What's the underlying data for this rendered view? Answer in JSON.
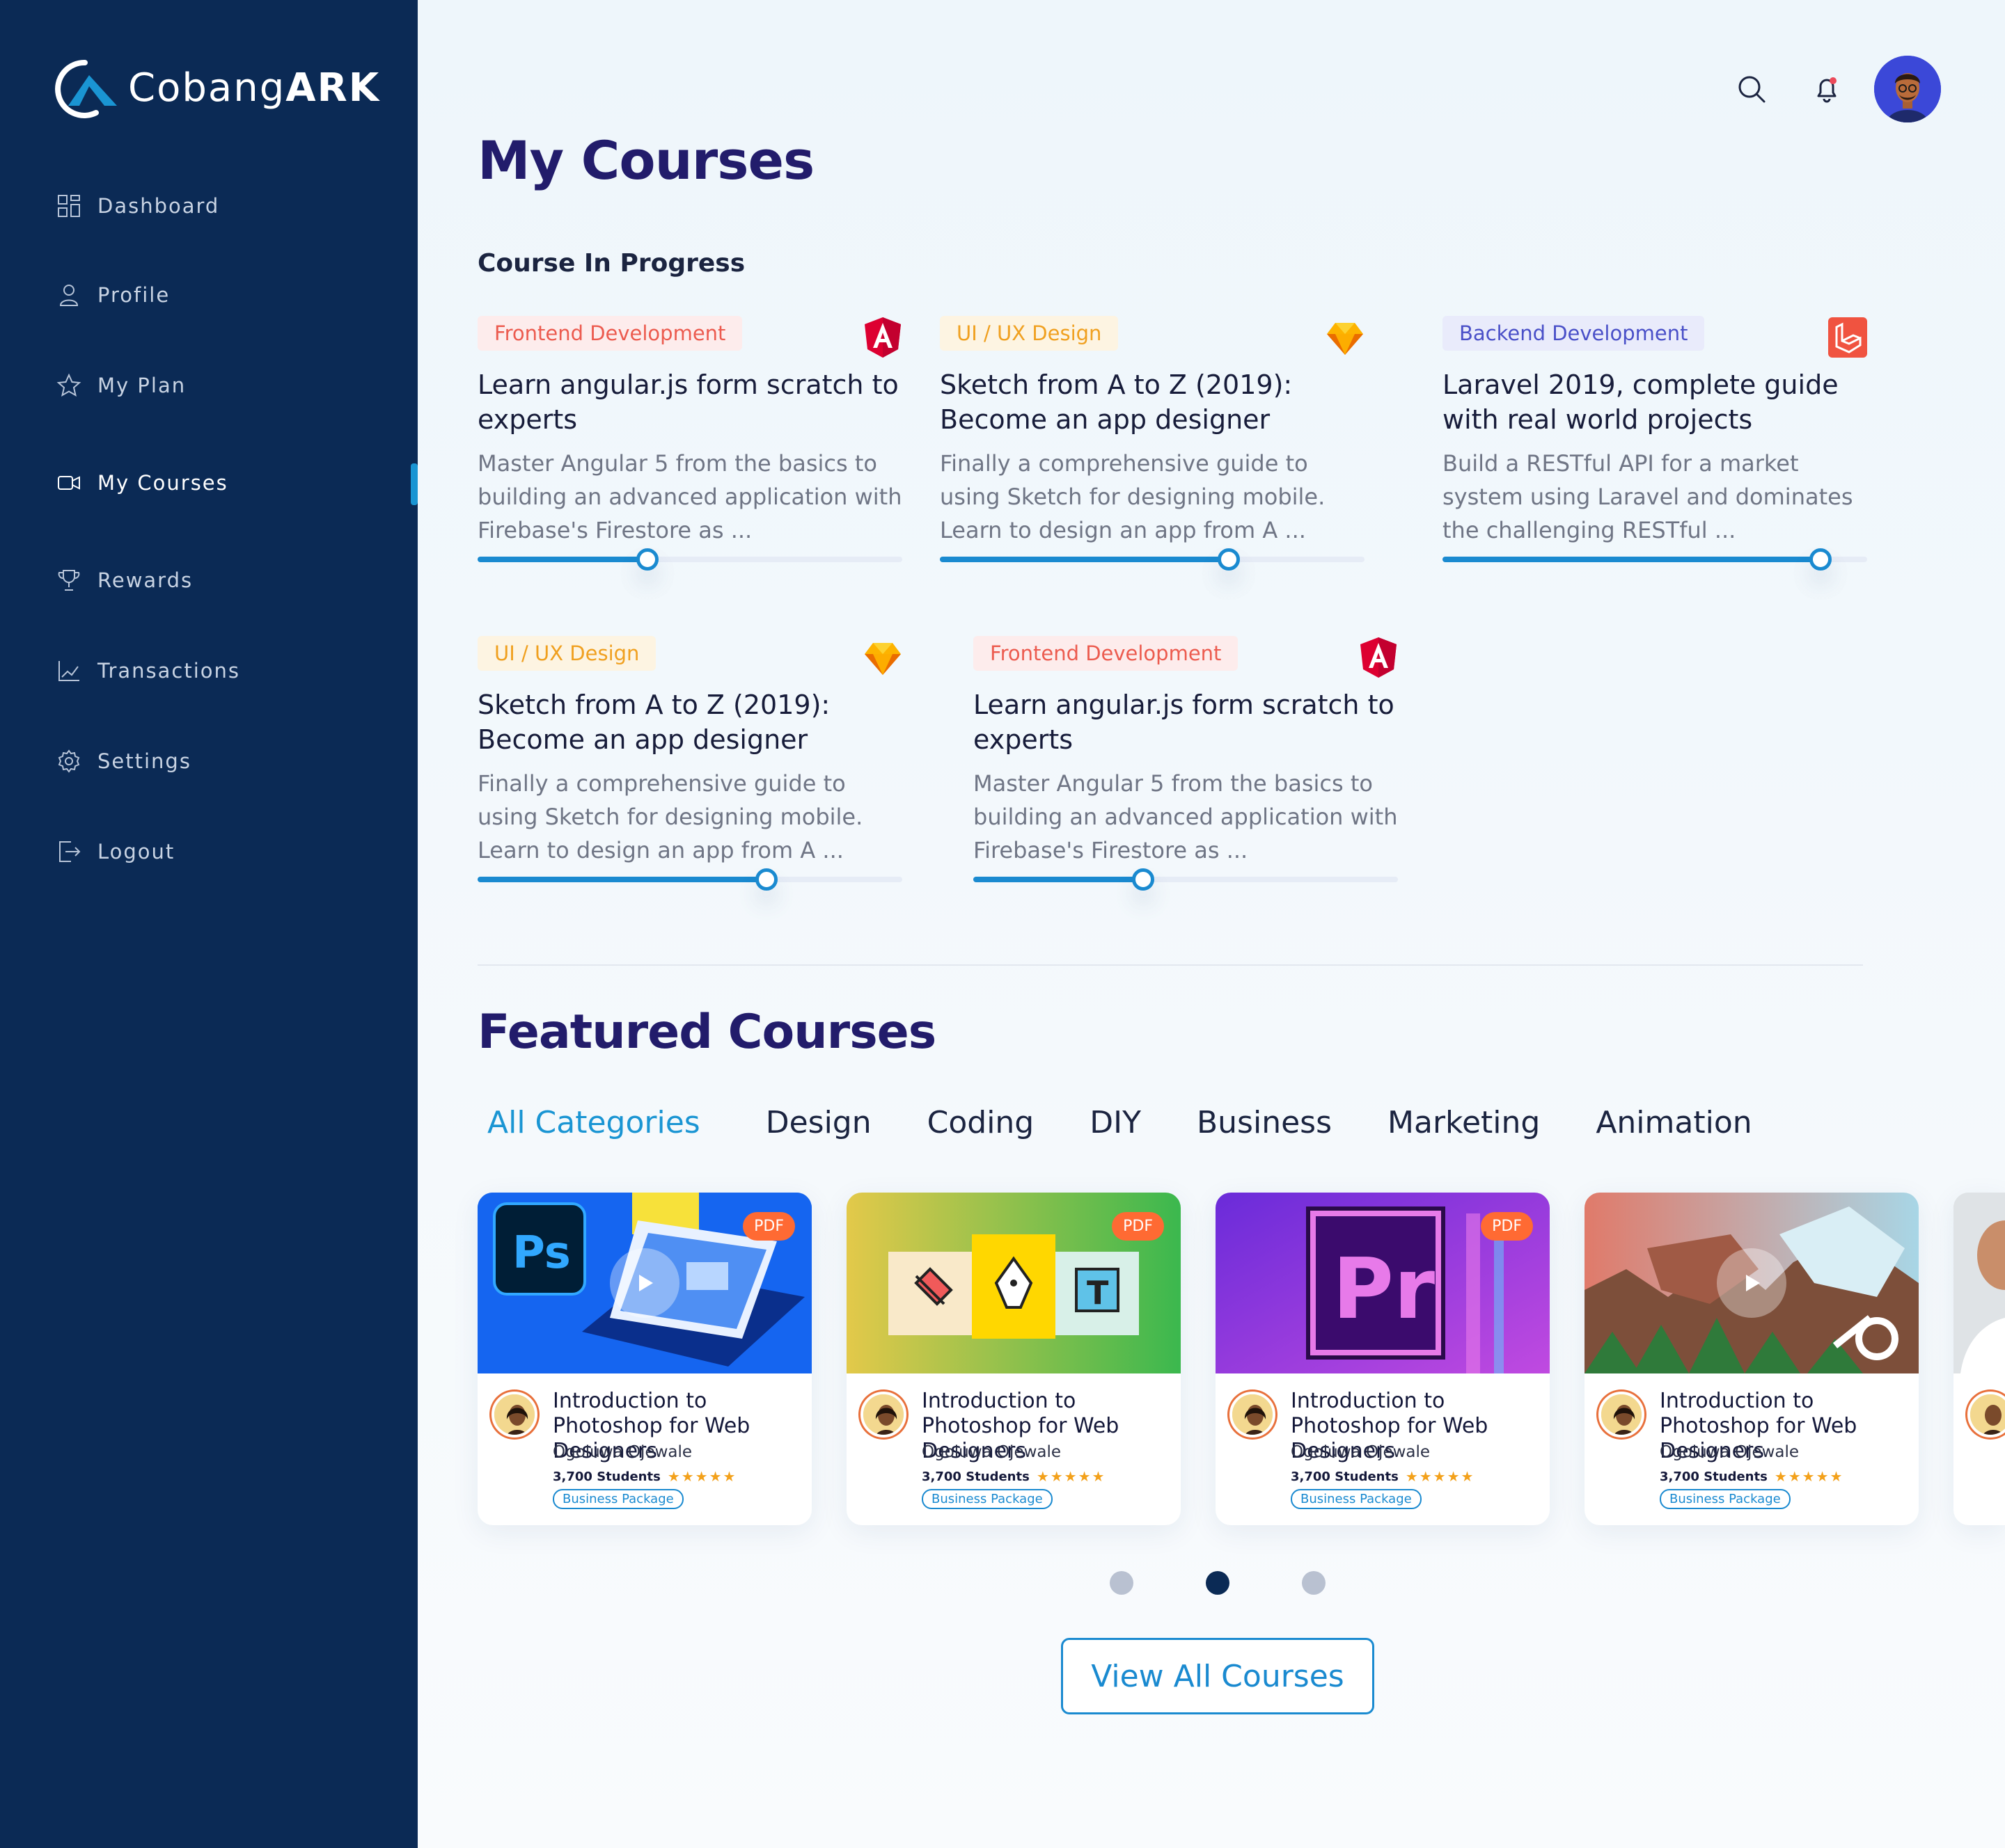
{
  "brand": {
    "name_light": "Cobang",
    "name_bold": "ARK"
  },
  "nav": [
    {
      "label": "Dashboard",
      "icon": "dashboard-icon",
      "active": false
    },
    {
      "label": "Profile",
      "icon": "user-icon",
      "active": false
    },
    {
      "label": "My Plan",
      "icon": "star-icon",
      "active": false
    },
    {
      "label": "My Courses",
      "icon": "video-icon",
      "active": true
    },
    {
      "label": "Rewards",
      "icon": "trophy-icon",
      "active": false
    },
    {
      "label": "Transactions",
      "icon": "chart-icon",
      "active": false
    },
    {
      "label": "Settings",
      "icon": "gear-icon",
      "active": false
    },
    {
      "label": "Logout",
      "icon": "logout-icon",
      "active": false
    }
  ],
  "header": {
    "icons": [
      "search-icon",
      "bell-icon",
      "avatar"
    ]
  },
  "page_title": "My Courses",
  "in_progress": {
    "heading": "Course In Progress",
    "courses": [
      {
        "tag": "Frontend Development",
        "tag_kind": "fe",
        "brand": "angular-icon",
        "title": "Learn angular.js form scratch to experts",
        "desc": "Master Angular 5 from the basics to building an advanced application with Firebase's Firestore as ...",
        "progress": 0.4
      },
      {
        "tag": "UI / UX Design",
        "tag_kind": "ux",
        "brand": "sketch-icon",
        "title": "Sketch from A to Z (2019): Become an app designer",
        "desc": "Finally a comprehensive guide to using Sketch for designing mobile. Learn to design an app from A ...",
        "progress": 0.68
      },
      {
        "tag": "Backend Development",
        "tag_kind": "be",
        "brand": "laravel-icon",
        "title": "Laravel 2019, complete guide with real world projects",
        "desc": "Build a RESTful API for a market system using Laravel and dominates the challenging RESTful ...",
        "progress": 0.89
      },
      {
        "tag": "UI / UX Design",
        "tag_kind": "ux",
        "brand": "sketch-icon",
        "title": "Sketch from A to Z (2019): Become an app designer",
        "desc": "Finally a comprehensive guide to using Sketch for designing mobile. Learn to design an app from A ...",
        "progress": 0.68
      },
      {
        "tag": "Frontend Development",
        "tag_kind": "fe",
        "brand": "angular-icon",
        "title": "Learn angular.js form scratch to experts",
        "desc": "Master Angular 5 from the basics to building an advanced application with Firebase's Firestore as ...",
        "progress": 0.4
      }
    ]
  },
  "featured": {
    "heading": "Featured Courses",
    "categories": [
      "All Categories",
      "Design",
      "Coding",
      "DIY",
      "Business",
      "Marketing",
      "Animation"
    ],
    "active_category": "All Categories",
    "cards": [
      {
        "thumb": "photoshop",
        "pdf": "PDF",
        "play": true,
        "title": "Introduction to Photoshop for Web Designers",
        "author": "Ogoluwa Ojewale",
        "students": "3,700 Students",
        "rating": "★★★★★",
        "package": "Business Package"
      },
      {
        "thumb": "design-tools",
        "pdf": "PDF",
        "play": false,
        "title": "Introduction to Photoshop for Web Designers",
        "author": "Ogoluwa Ojewale",
        "students": "3,700 Students",
        "rating": "★★★★★",
        "package": "Business Package"
      },
      {
        "thumb": "premiere",
        "pdf": "PDF",
        "play": false,
        "title": "Introduction to Photoshop for Web Designers",
        "author": "Ogoluwa Ojewale",
        "students": "3,700 Students",
        "rating": "★★★★★",
        "package": "Business Package"
      },
      {
        "thumb": "blender",
        "pdf": "",
        "play": true,
        "title": "Introduction to Photoshop for Web Designers",
        "author": "Ogoluwa Ojewale",
        "students": "3,700 Students",
        "rating": "★★★★★",
        "package": "Business Package"
      }
    ],
    "pagination": {
      "pages": 3,
      "current": 2
    },
    "view_all": "View All Courses"
  },
  "colors": {
    "sidebar": "#0b2a55",
    "accent": "#1a95d3",
    "title": "#221c6b",
    "pdf": "#ff6a33",
    "star": "#f3a11b"
  }
}
